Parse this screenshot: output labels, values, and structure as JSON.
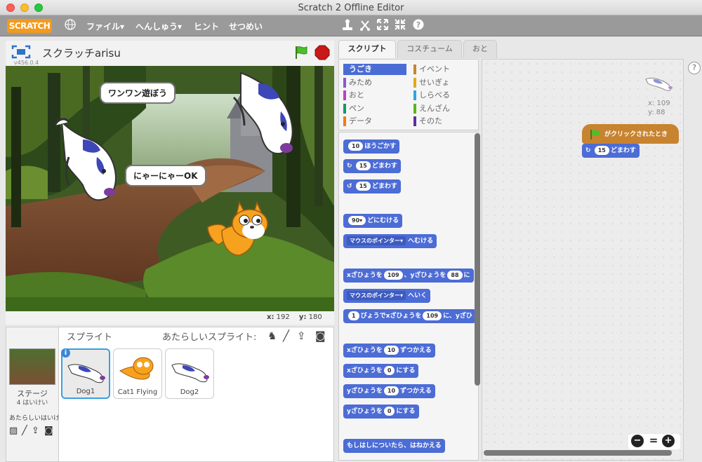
{
  "window": {
    "title": "Scratch 2 Offline Editor"
  },
  "menubar": {
    "logo": "SCRATCH",
    "file": "ファイル▾",
    "edit": "へんしゅう▾",
    "tips": "ヒント",
    "about": "せつめい"
  },
  "stage": {
    "project_title": "スクラッチarisu",
    "version": "v456.0.4",
    "bubble1": "ワンワン遊ぼう",
    "bubble2": "にゃーにゃーOK",
    "coords": {
      "x_label": "x:",
      "x": "192",
      "y_label": "y:",
      "y": "180"
    }
  },
  "sprites": {
    "header": "スプライト",
    "new_sprite": "あたらしいスプライト:",
    "stage_label": "ステージ",
    "stage_count": "4 はいけい",
    "new_backdrop": "あたらしいはいけ",
    "items": [
      {
        "name": "Dog1",
        "selected": true
      },
      {
        "name": "Cat1 Flying",
        "selected": false
      },
      {
        "name": "Dog2",
        "selected": false
      }
    ]
  },
  "tabs": [
    "スクリプト",
    "コスチューム",
    "おと"
  ],
  "categories": {
    "left": [
      {
        "label": "うごき",
        "color": "#4a6cd4",
        "active": true
      },
      {
        "label": "みため",
        "color": "#8a55d7"
      },
      {
        "label": "おと",
        "color": "#bb42c3"
      },
      {
        "label": "ペン",
        "color": "#0e9a6c"
      },
      {
        "label": "データ",
        "color": "#ee7d16"
      }
    ],
    "right": [
      {
        "label": "イベント",
        "color": "#c88330"
      },
      {
        "label": "せいぎょ",
        "color": "#e1a91a"
      },
      {
        "label": "しらべる",
        "color": "#2ca5e2"
      },
      {
        "label": "えんざん",
        "color": "#5cb712"
      },
      {
        "label": "そのた",
        "color": "#632d99"
      }
    ]
  },
  "blocks": {
    "move": {
      "v": "10",
      "t": "ほうごかす"
    },
    "turn_cw": {
      "v": "15",
      "t": "どまわす"
    },
    "turn_ccw": {
      "v": "15",
      "t": "どまわす"
    },
    "point_dir": {
      "v": "90▾",
      "t": "どにむける"
    },
    "point_towards": {
      "dd": "マウスのポインター▾",
      "t": "へむける"
    },
    "goto_xy": {
      "t1": "xざひょうを",
      "v1": "109",
      "t2": "、yざひょうを",
      "v2": "88",
      "t3": "に"
    },
    "goto": {
      "dd": "マウスのポインター▾",
      "t": "へいく"
    },
    "glide": {
      "v1": "1",
      "t1": "びょうでxざひょうを",
      "v2": "109",
      "t2": "に、yざひ"
    },
    "change_x": {
      "t1": "xざひょうを",
      "v": "10",
      "t2": "ずつかえる"
    },
    "set_x": {
      "t1": "xざひょうを",
      "v": "0",
      "t2": "にする"
    },
    "change_y": {
      "t1": "yざひょうを",
      "v": "10",
      "t2": "ずつかえる"
    },
    "set_y": {
      "t1": "yざひょうを",
      "v": "0",
      "t2": "にする"
    },
    "bounce": {
      "t": "もしはしについたら、はねかえる"
    }
  },
  "script": {
    "sprite_x": "x: 109",
    "sprite_y": "y: 88",
    "hat": "がクリックされたとき",
    "turn": {
      "v": "15",
      "t": "どまわす"
    }
  },
  "zoom": {
    "out": "−",
    "reset": "=",
    "in": "+"
  },
  "help": "?"
}
